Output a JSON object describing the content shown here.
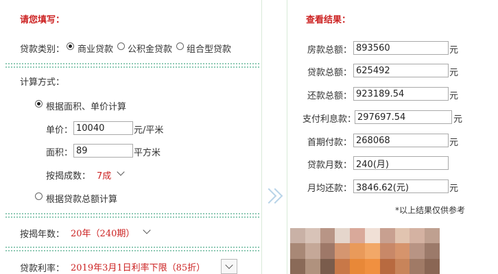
{
  "input_section": {
    "title": "请您填写：",
    "loan_type": {
      "label": "贷款类别：",
      "options": [
        "商业贷款",
        "公积金贷款",
        "组合型贷款"
      ],
      "selected": "商业贷款"
    },
    "calc_method": {
      "label": "计算方式：",
      "option_area": "根据面积、单价计算",
      "option_total": "根据贷款总额计算",
      "selected": "根据面积、单价计算",
      "unit_price": {
        "label": "单价：",
        "value": "10040",
        "unit": "元/平米"
      },
      "area": {
        "label": "面积：",
        "value": "89",
        "unit": "平方米"
      },
      "down_ratio": {
        "label": "按揭成数：",
        "value": "7成"
      }
    },
    "years": {
      "label": "按揭年数：",
      "value": "20年（240期）"
    },
    "rate": {
      "label": "贷款利率：",
      "value": "2019年3月1日利率下限（85折）"
    }
  },
  "results": {
    "title": "查看结果：",
    "rows": [
      {
        "label": "房款总额：",
        "value": "893560",
        "unit": "元"
      },
      {
        "label": "贷款总额：",
        "value": "625492",
        "unit": "元"
      },
      {
        "label": "还款总额：",
        "value": "923189.54",
        "unit": "元"
      },
      {
        "label": "支付利息款：",
        "value": "297697.54",
        "unit": "元"
      },
      {
        "label": "首期付款：",
        "value": "268068",
        "unit": "元"
      },
      {
        "label": "贷款月数：",
        "value": "240(月)",
        "unit": ""
      },
      {
        "label": "月均还款：",
        "value": "3846.62(元)",
        "unit": "元"
      }
    ],
    "note": "*以上结果仅供参考"
  },
  "colors": {
    "accent_red": "#cc2222",
    "divider_green": "#8fcab5"
  }
}
